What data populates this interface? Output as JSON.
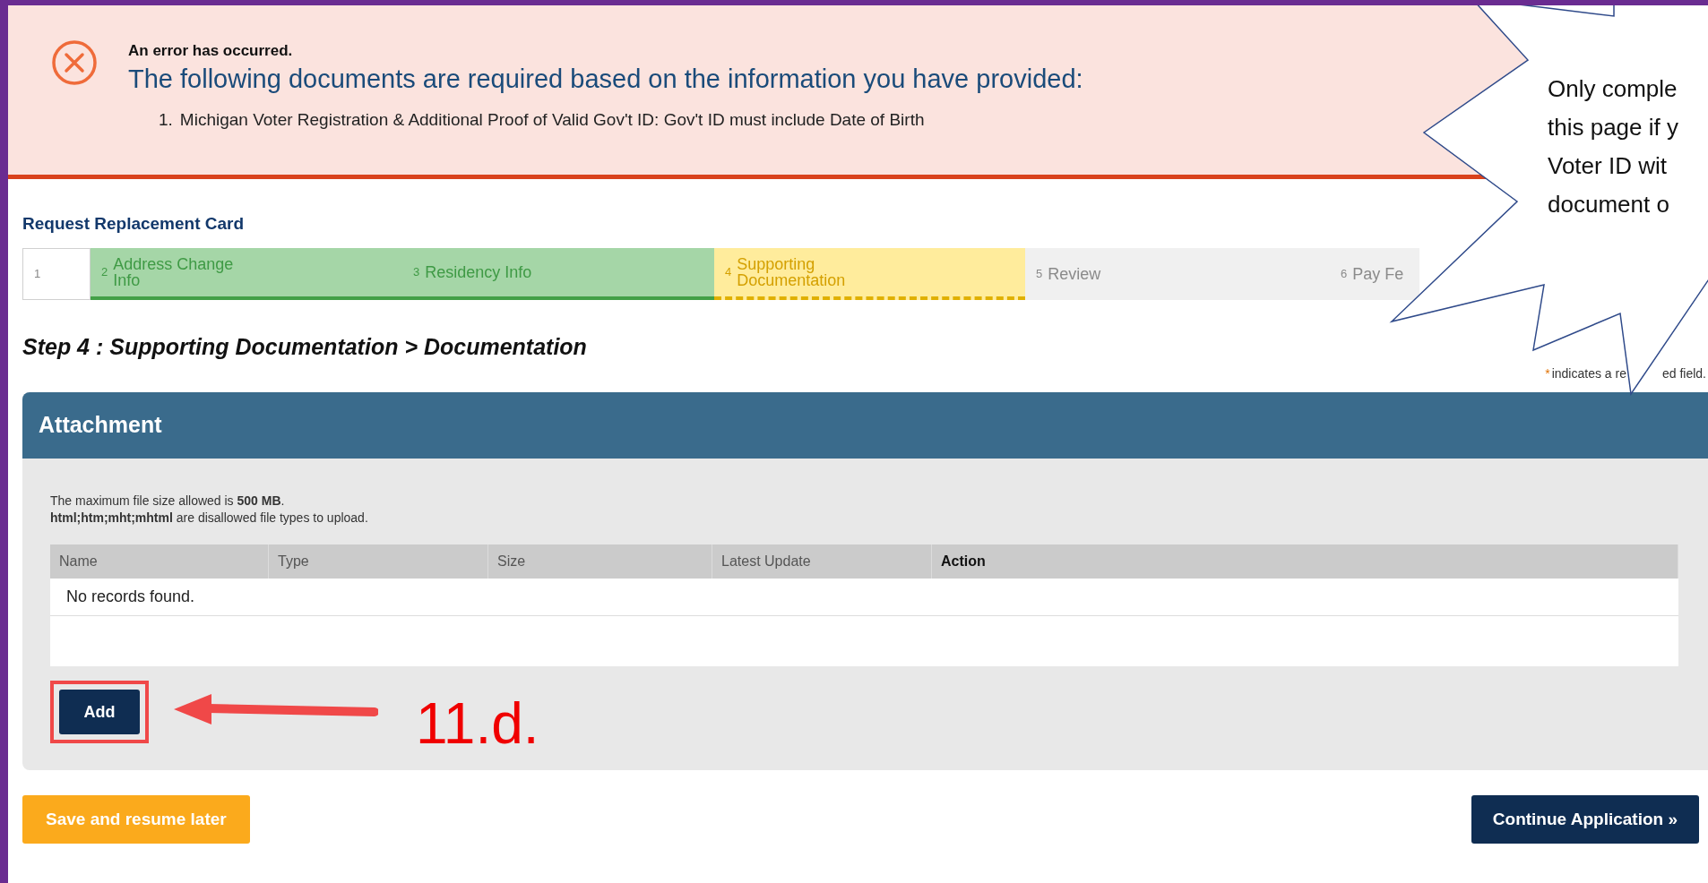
{
  "error_banner": {
    "title": "An error has occurred.",
    "headline": "The following documents are required based on the information you have provided:",
    "items": [
      {
        "number": "1.",
        "text": "Michigan Voter Registration & Additional Proof of Valid Gov't ID: Gov't ID must include Date of Birth"
      }
    ]
  },
  "form_title": "Request Replacement Card",
  "steps": [
    {
      "number": "1",
      "kind": "blank",
      "selected": false
    },
    {
      "number": "2",
      "label": "Address Change Info",
      "kind": "complete",
      "selected": false
    },
    {
      "number": "3",
      "label": "Residency Info",
      "kind": "complete",
      "selected": false
    },
    {
      "number": "4",
      "label": "Supporting Documentation",
      "kind": "upcoming",
      "selected": true
    },
    {
      "number": "5",
      "label": "Review",
      "kind": "upcoming",
      "selected": false
    },
    {
      "number": "6",
      "label": "Pay Fe",
      "kind": "upcoming",
      "selected": false
    }
  ],
  "step_heading": "Step 4 : Supporting Documentation > Documentation",
  "required_note": {
    "mark": "*",
    "text_left": "indicates a re",
    "text_right": "ed field."
  },
  "attachment": {
    "title": "Attachment",
    "notes": [
      "The maximum file size allowed is **500 MB**.",
      "**html;htm;mht;mhtml** are disallowed file types to upload."
    ],
    "columns": [
      {
        "label": "Name",
        "bold": false
      },
      {
        "label": "Type",
        "bold": false
      },
      {
        "label": "Size",
        "bold": false
      },
      {
        "label": "Latest Update",
        "bold": false
      },
      {
        "label": "Action",
        "bold": true
      }
    ],
    "empty_message": "No records found.",
    "add_button": "Add"
  },
  "annotation": {
    "label": "11.d.",
    "callout_lines": [
      "Only comple",
      "this page if y",
      "Voter ID wit",
      "document o"
    ]
  },
  "buttons": {
    "save": "Save and resume later",
    "continue": "Continue Application »"
  }
}
